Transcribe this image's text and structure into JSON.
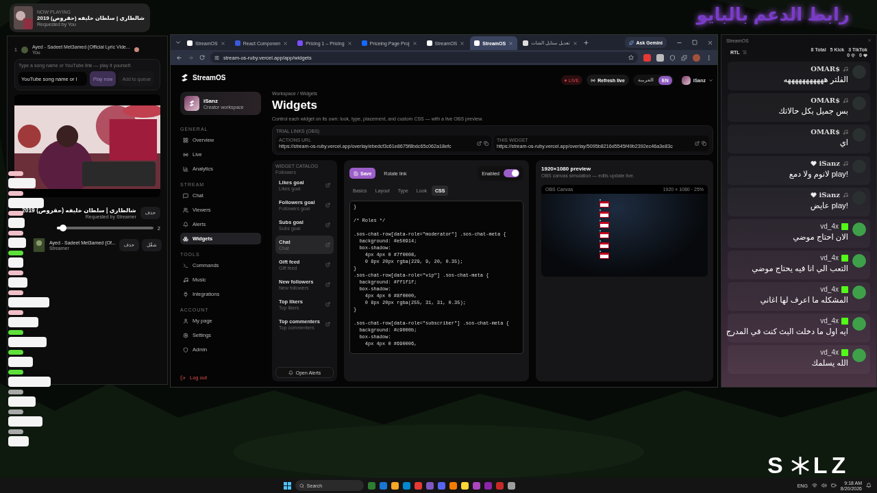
{
  "desktop_banner": "رابط الدعم بالبايو",
  "logo": {
    "left": "S",
    "right": "LZ"
  },
  "now_playing": {
    "label": "NOW PLAYING",
    "title": "شالطاري | سلطان خليفه (حقروص) 2019",
    "requested": "Requested by You"
  },
  "music_panel": {
    "current": {
      "index": "1",
      "title": "Ayed - Sadeet Met3amed (Official Lyric Vide...",
      "by": "You"
    },
    "hint": "Type a song name or YouTube link — play it yourself.",
    "input": {
      "placeholder": "YouTube song name or l"
    },
    "buttons": [
      "Play now",
      "Add to queue"
    ],
    "playing": {
      "title": "شالطاري | سلطان خليفه (حقروص) 2019",
      "requested": "Requested by Streamer",
      "action": "حذف"
    },
    "volume": {
      "level": 0.03,
      "reading": "2"
    },
    "queue": [
      {
        "title": "Ayed - Sadeet Met3amed (Of...",
        "by": "Streamer",
        "actions": [
          "شغّل",
          "حذف"
        ]
      }
    ]
  },
  "browser": {
    "tabs": [
      {
        "title": "StreamOS",
        "selected": false
      },
      {
        "title": "React Componen",
        "selected": false
      },
      {
        "title": "Pricing 1 – Pricing",
        "selected": false
      },
      {
        "title": "Priceing Page Proj",
        "selected": false
      },
      {
        "title": "StreamOS",
        "selected": false
      },
      {
        "title": "StreamOS",
        "selected": true
      },
      {
        "title": "تعديل ستايل الشات",
        "selected": false
      }
    ],
    "gemini": "Ask Gemini",
    "url": "stream-os-ruby.vercel.app/app/widgets"
  },
  "app": {
    "brand": "StreamOS",
    "live": "LIVE",
    "refresh": "Refresh live",
    "langs": [
      {
        "label": "العربية",
        "selected": false
      },
      {
        "label": "EN",
        "selected": true
      }
    ],
    "user": "iSanz",
    "workspace": {
      "name": "iSanz",
      "sub": "Creator workspace"
    },
    "sections": [
      {
        "title": "GENERAL",
        "items": [
          {
            "label": "Overview",
            "selected": false
          },
          {
            "label": "Live",
            "selected": false
          },
          {
            "label": "Analytics",
            "selected": false
          }
        ]
      },
      {
        "title": "STREAM",
        "items": [
          {
            "label": "Chat",
            "selected": false
          },
          {
            "label": "Viewers",
            "selected": false
          },
          {
            "label": "Alerts",
            "selected": false
          },
          {
            "label": "Widgets",
            "selected": true
          }
        ]
      },
      {
        "title": "TOOLS",
        "items": [
          {
            "label": "Commands",
            "selected": false
          },
          {
            "label": "Music",
            "selected": false
          },
          {
            "label": "Integrations",
            "selected": false
          }
        ]
      },
      {
        "title": "ACCOUNT",
        "items": [
          {
            "label": "My page",
            "selected": false
          },
          {
            "label": "Settings",
            "selected": false
          },
          {
            "label": "Admin",
            "selected": false
          }
        ]
      }
    ],
    "logout": "Log out",
    "breadcrumb": "Workspace / Widgets",
    "title": "Widgets",
    "description": "Control each widget on its own: look, type, placement, and custom CSS — with a live OBS preview.",
    "trial": {
      "label": "TRIAL LINKS (OBS)",
      "links": [
        {
          "label": "ACTIONS URL",
          "url": "https://stream-os-ruby.vercel.app/overlay/ebedcf3c61e8675f8bdc65c062a18efc"
        },
        {
          "label": "THIS WIDGET",
          "url": "https://stream-os-ruby.vercel.app/overlay/5095b8216d5545f49b2392ec46a3e83c"
        }
      ]
    },
    "catalog": {
      "title": "WIDGET CATALOG",
      "cut_label": "Followers",
      "items": [
        {
          "name": "Likes goal",
          "sub": "Likes goal",
          "selected": false
        },
        {
          "name": "Followers goal",
          "sub": "Followers goal",
          "selected": false
        },
        {
          "name": "Subs goal",
          "sub": "Subs goal",
          "selected": false
        },
        {
          "name": "Chat",
          "sub": "Chat",
          "selected": true
        },
        {
          "name": "Gift feed",
          "sub": "Gift feed",
          "selected": false
        },
        {
          "name": "New followers",
          "sub": "New followers",
          "selected": false
        },
        {
          "name": "Top likers",
          "sub": "Top likers",
          "selected": false
        },
        {
          "name": "Top commenters",
          "sub": "Top commenters",
          "selected": false
        }
      ],
      "open_alerts": "Open Alerts"
    },
    "editor": {
      "save": "Save",
      "rotate": "Rotate link",
      "enabled": {
        "label": "Enabled",
        "on": true
      },
      "tabs": [
        {
          "label": "Basics",
          "selected": false
        },
        {
          "label": "Layout",
          "selected": false
        },
        {
          "label": "Type",
          "selected": false
        },
        {
          "label": "Look",
          "selected": false
        },
        {
          "label": "CSS",
          "selected": true
        }
      ],
      "code": "}\n\n/* Roles */\n\n.sos-chat-row[data-role=\"moderator\"] .sos-chat-meta {\n  background: #e50914;\n  box-shadow:\n    4px 4px 0 #7f0008,\n    0 8px 20px rgba(229, 9, 20, 0.35);\n}\n.sos-chat-row[data-role=\"vip\"] .sos-chat-meta {\n  background: #ff1f1f;\n  box-shadow:\n    4px 4px 0 #8f0000,\n    0 8px 20px rgba(255, 31, 31, 0.35);\n}\n\n.sos-chat-row[data-role=\"subscriber\"] .sos-chat-meta {\n  background: #c9000b;\n  box-shadow:\n    4px 4px 0 #690006,"
    },
    "preview": {
      "title": "1920×1080 preview",
      "sub": "OBS canvas simulation — edits update live.",
      "canvas": "OBS Canvas",
      "scale": "1920 × 1080 · 25%"
    }
  },
  "chat_window": {
    "title": "StreamOS",
    "rtl": "RTL",
    "stats": [
      "8 Total",
      "5 Kick",
      "3 TikTok"
    ],
    "counts": [
      "0",
      "0"
    ],
    "messages": [
      {
        "user": "OMAR$",
        "kind": "tiktok",
        "heart": false,
        "text": "الفلتر هههههههههههه"
      },
      {
        "user": "OMAR$",
        "kind": "tiktok",
        "heart": false,
        "text": "بس جميل بكل حالاتك"
      },
      {
        "user": "OMAR$",
        "kind": "tiktok",
        "heart": false,
        "text": "اي"
      },
      {
        "user": "iSanz",
        "kind": "tiktok",
        "heart": true,
        "text": "!play لانوم ولا دمع"
      },
      {
        "user": "iSanz",
        "kind": "tiktok",
        "heart": true,
        "text": "!play عايض"
      },
      {
        "user": "vd_4x",
        "kind": "kick",
        "heart": false,
        "text": "الان احتاج موضي"
      },
      {
        "user": "vd_4x",
        "kind": "kick",
        "heart": false,
        "text": "التعب الي انا فيه يحتاج موضي"
      },
      {
        "user": "vd_4x",
        "kind": "kick",
        "heart": false,
        "text": "المشكله ما اعرف لها اغاني"
      },
      {
        "user": "vd_4x",
        "kind": "kick",
        "heart": false,
        "text": "ايه اول ما دخلت البث كنت في المدرج"
      },
      {
        "user": "vd_4x",
        "kind": "kick",
        "heart": false,
        "text": "الله يسلمك"
      }
    ]
  },
  "taskbar": {
    "search": "Search",
    "lang": "ENG",
    "time": "9:18 AM",
    "date": "8/20/2026"
  }
}
